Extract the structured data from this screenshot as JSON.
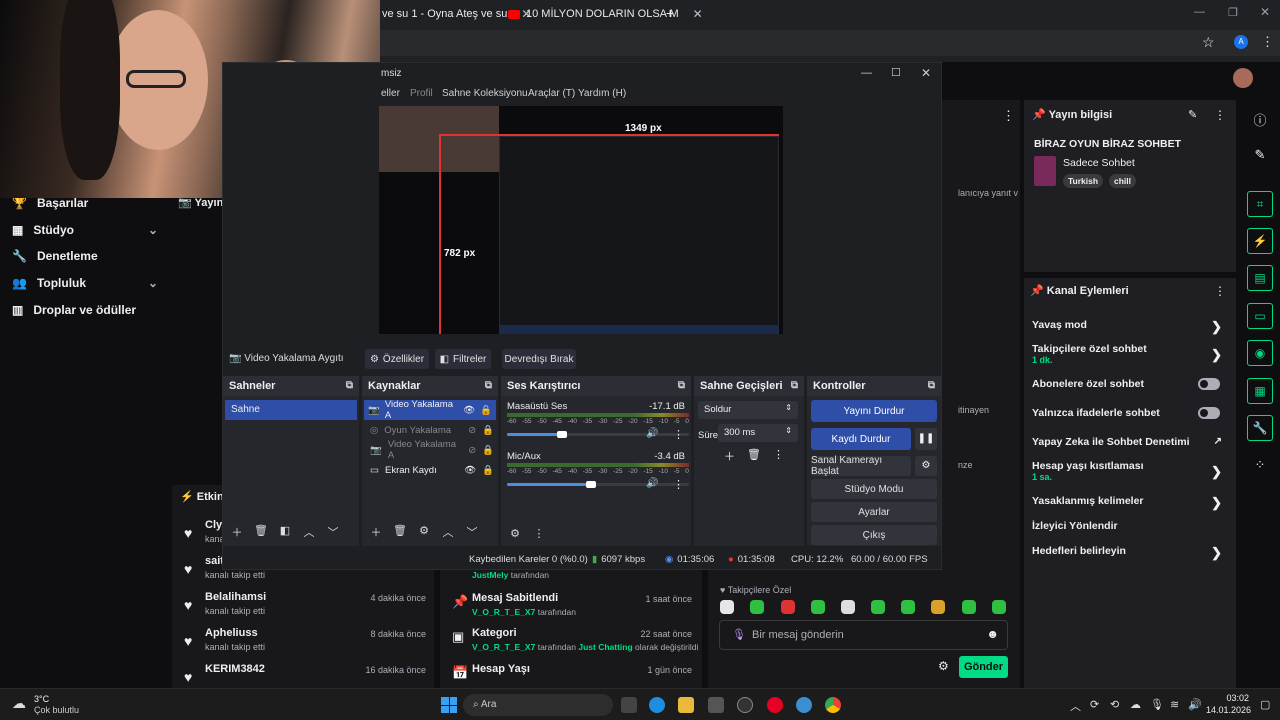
{
  "browser": {
    "tabs": [
      {
        "label": "ve su 1 - Oyna Ateş ve su"
      },
      {
        "label": "10 MİLYON DOLARIN OLSA M"
      }
    ],
    "new_tab": "+"
  },
  "twitch": {
    "left_nav": [
      {
        "label": "Başarılar"
      },
      {
        "label": "Stüdyo"
      },
      {
        "label": "Denetleme"
      },
      {
        "label": "Topluluk"
      },
      {
        "label": "Droplar ve ödüller"
      }
    ],
    "yayin_label": "Yayın",
    "activity": {
      "header": "Etkinli",
      "items": [
        {
          "name": "Cly",
          "sub": "kanalı",
          "time": ""
        },
        {
          "name": "sait",
          "sub": "kanalı takip etti",
          "time": ""
        },
        {
          "name": "Belalihamsi",
          "sub": "kanalı takip etti",
          "time": "4 dakika önce"
        },
        {
          "name": "Apheliuss",
          "sub": "kanalı takip etti",
          "time": "8 dakika önce"
        },
        {
          "name": "KERIM3842",
          "sub": "kanalı takip etti",
          "time": "16 dakika önce"
        }
      ]
    },
    "events": [
      {
        "title": "",
        "desc_user": "JustMely",
        "desc_rest": "tarafından",
        "time": ""
      },
      {
        "title": "Mesaj Sabitlendi",
        "desc_user": "V_O_R_T_E_X7",
        "desc_rest": "tarafından",
        "time": "1 saat önce"
      },
      {
        "title": "Kategori",
        "desc_user": "V_O_R_T_E_X7",
        "desc_rest": "tarafından",
        "desc_user2": "Just Chatting",
        "desc_rest2": "olarak değiştirildi",
        "time": "22 saat önce"
      },
      {
        "title": "Hesap Yaşı",
        "desc_user": "",
        "desc_rest": "",
        "time": "1 gün önce"
      }
    ],
    "chat": {
      "peek_texts": [
        "lanıcıya yanıt v",
        "itinayen",
        "nze"
      ],
      "follower_label": "Takipçilere Özel",
      "placeholder": "Bir mesaj gönderin",
      "send": "Gönder"
    },
    "stream_info": {
      "header": "Yayın bilgisi",
      "title": "BİRAZ OYUN BİRAZ SOHBET",
      "category": "Sadece Sohbet",
      "tags": [
        "Turkish",
        "chill"
      ]
    },
    "channel_actions": {
      "header": "Kanal Eylemleri",
      "items": [
        {
          "label": "Yavaş mod",
          "sub": ""
        },
        {
          "label": "Takipçilere özel sohbet",
          "sub": "1 dk."
        },
        {
          "label": "Abonelere özel sohbet",
          "sub": ""
        },
        {
          "label": "Yalnızca ifadelerle sohbet",
          "sub": ""
        },
        {
          "label": "Yapay Zeka ile Sohbet Denetimi",
          "sub": ""
        },
        {
          "label": "Hesap yaşı kısıtlaması",
          "sub": "1 sa."
        },
        {
          "label": "Yasaklanmış kelimeler",
          "sub": ""
        },
        {
          "label": "İzleyici Yönlendir",
          "sub": ""
        },
        {
          "label": "Hedefleri belirleyin",
          "sub": ""
        }
      ]
    }
  },
  "obs": {
    "title": "msiz",
    "menu": [
      "eller",
      "Profil",
      "Sahne Koleksiyonu",
      "Araçlar (T)",
      "Yardım (H)"
    ],
    "preview_labels": {
      "width": "1349 px",
      "height": "782 px"
    },
    "source_bar": {
      "source_name": "Video Yakalama Aygıtı",
      "properties": "Özellikler",
      "filters": "Filtreler",
      "deactivate": "Devredışı Bırak"
    },
    "scenes": {
      "header": "Sahneler",
      "items": [
        "Sahne"
      ]
    },
    "sources": {
      "header": "Kaynaklar",
      "items": [
        {
          "name": "Video Yakalama A",
          "visible": true
        },
        {
          "name": "Oyun Yakalama",
          "visible": false
        },
        {
          "name": "Video Yakalama A",
          "visible": false
        },
        {
          "name": "Ekran Kaydı",
          "visible": true
        }
      ]
    },
    "mixer": {
      "header": "Ses Karıştırıcı",
      "channels": [
        {
          "name": "Masaüstü Ses",
          "db": "-17.1 dB",
          "level": 0.39
        },
        {
          "name": "Mic/Aux",
          "db": "-3.4 dB",
          "level": 0.6
        }
      ],
      "scale": [
        "-60",
        "-55",
        "-50",
        "-45",
        "-40",
        "-35",
        "-30",
        "-25",
        "-20",
        "-15",
        "-10",
        "-5",
        "0"
      ]
    },
    "transitions": {
      "header": "Sahne Geçişleri",
      "type": "Soldur",
      "duration_label": "Süre",
      "duration": "300 ms"
    },
    "controls": {
      "header": "Kontroller",
      "start_stream": "Yayını Durdur",
      "record": "Kaydı Durdur",
      "virtual_cam": "Sanal Kamerayı Başlat",
      "studio": "Stüdyo Modu",
      "settings": "Ayarlar",
      "exit": "Çıkış"
    },
    "status": {
      "dropped": "Kaybedilen Kareler 0 (%0.0)",
      "bitrate": "6097 kbps",
      "stream_time": "01:35:06",
      "rec_time": "01:35:08",
      "cpu": "CPU: 12.2%",
      "fps": "60.00 / 60.00 FPS"
    }
  },
  "taskbar": {
    "weather_temp": "3°C",
    "weather_desc": "Çok bulutlu",
    "search": "Ara",
    "time": "03:02",
    "date": "14.01.2026"
  },
  "colors": {
    "twitch_green": "#00db84",
    "obs_blue": "#2f4ea7"
  }
}
